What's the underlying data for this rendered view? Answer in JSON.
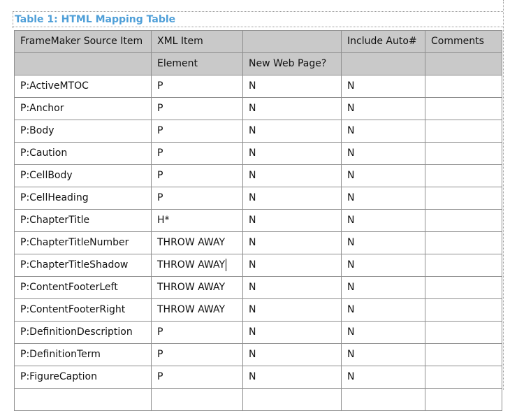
{
  "title": "Table 1: HTML Mapping Table",
  "header_row_1": [
    "FrameMaker Source Item",
    "XML Item",
    "",
    "Include Auto#",
    "Comments"
  ],
  "header_row_2": [
    "",
    "Element",
    "New Web Page?",
    "",
    ""
  ],
  "rows": [
    [
      "P:ActiveMTOC",
      "P",
      "N",
      "N",
      ""
    ],
    [
      "P:Anchor",
      "P",
      "N",
      "N",
      ""
    ],
    [
      "P:Body",
      "P",
      "N",
      "N",
      ""
    ],
    [
      "P:Caution",
      "P",
      "N",
      "N",
      ""
    ],
    [
      "P:CellBody",
      "P",
      "N",
      "N",
      ""
    ],
    [
      "P:CellHeading",
      "P",
      "N",
      "N",
      ""
    ],
    [
      "P:ChapterTitle",
      "H*",
      "N",
      "N",
      ""
    ],
    [
      "P:ChapterTitleNumber",
      "THROW AWAY",
      "N",
      "N",
      ""
    ],
    [
      "P:ChapterTitleShadow",
      "THROW AWAY",
      "N",
      "N",
      ""
    ],
    [
      "P:ContentFooterLeft",
      "THROW AWAY",
      "N",
      "N",
      ""
    ],
    [
      "P:ContentFooterRight",
      "THROW AWAY",
      "N",
      "N",
      ""
    ],
    [
      "P:DefinitionDescription",
      "P",
      "N",
      "N",
      ""
    ],
    [
      "P:DefinitionTerm",
      "P",
      "N",
      "N",
      ""
    ],
    [
      "P:FigureCaption",
      "P",
      "N",
      "N",
      ""
    ],
    [
      "",
      "",
      "",
      "",
      ""
    ]
  ]
}
